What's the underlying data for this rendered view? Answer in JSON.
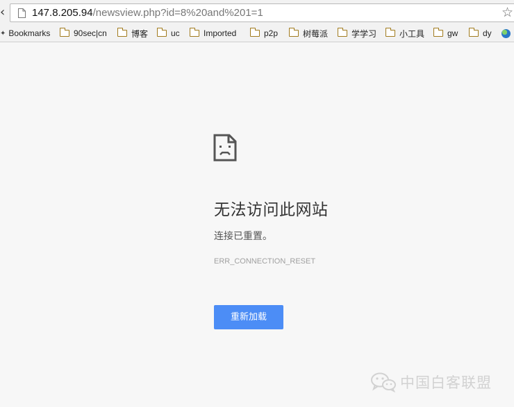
{
  "address_bar": {
    "url_host": "147.8.205.94",
    "url_path": "/newsview.php?id=8%20and%201=1"
  },
  "bookmarks": [
    {
      "label": "Bookmarks",
      "icon": "star-icon"
    },
    {
      "label": "90sec|cn",
      "icon": "folder-icon"
    },
    {
      "label": "博客",
      "icon": "folder-icon"
    },
    {
      "label": "uc",
      "icon": "folder-icon"
    },
    {
      "label": "Imported",
      "icon": "folder-icon"
    },
    {
      "label": "p2p",
      "icon": "folder-icon"
    },
    {
      "label": "树莓派",
      "icon": "folder-icon"
    },
    {
      "label": "学学习",
      "icon": "folder-icon"
    },
    {
      "label": "小工具",
      "icon": "folder-icon"
    },
    {
      "label": "gw",
      "icon": "folder-icon"
    },
    {
      "label": "dy",
      "icon": "folder-icon"
    },
    {
      "label": "",
      "icon": "globe-icon"
    }
  ],
  "error_page": {
    "title": "无法访问此网站",
    "description": "连接已重置。",
    "error_code": "ERR_CONNECTION_RESET",
    "reload_label": "重新加载",
    "accent_color": "#4c8df6"
  },
  "watermark": {
    "text": "中国白客联盟",
    "icon": "wechat-icon"
  }
}
